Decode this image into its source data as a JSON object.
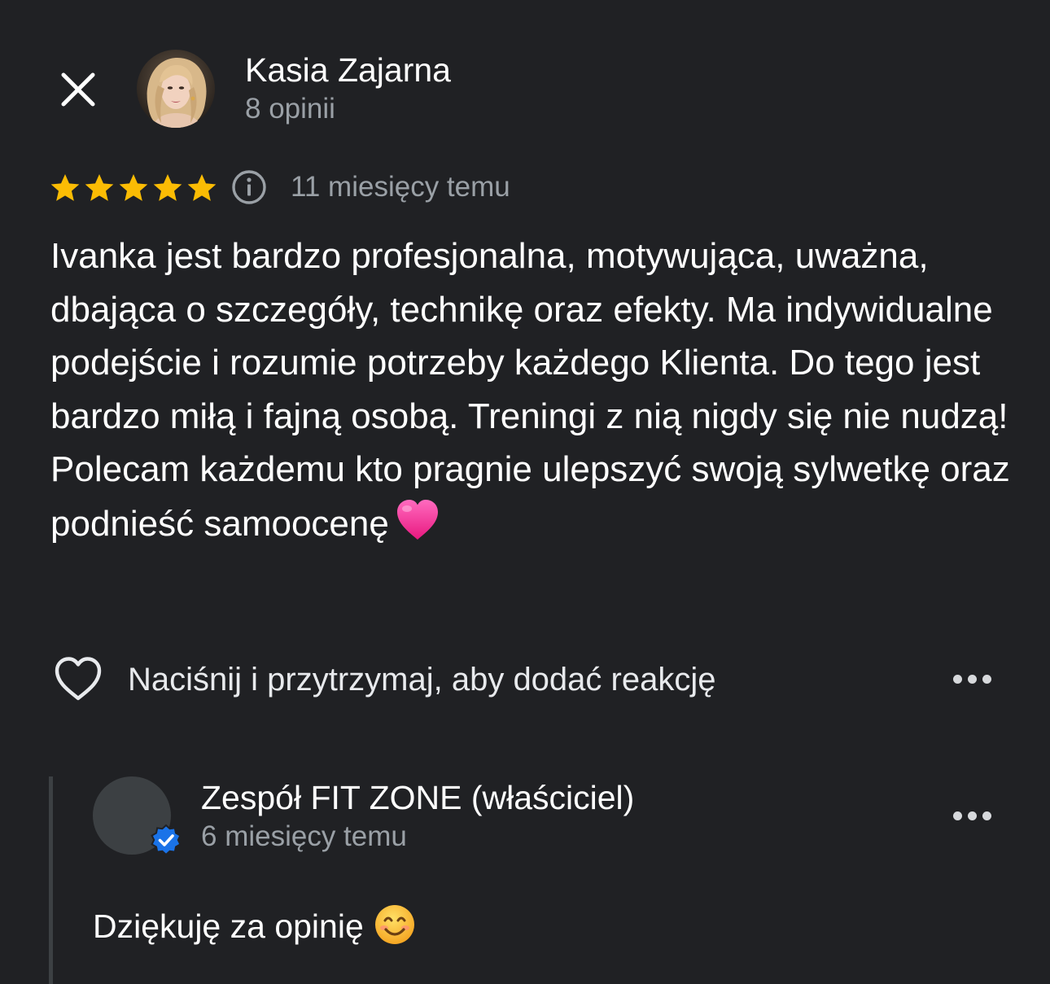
{
  "review": {
    "author": {
      "name": "Kasia Zajarna",
      "reviews_count": "8 opinii",
      "avatar": "profile-photo"
    },
    "rating": 5,
    "rating_max": 5,
    "time": "11 miesięcy temu",
    "text": "Ivanka jest bardzo profesjonalna, motywująca, uważna, dbająca o szczegóły, technikę oraz efekty. Ma indywidualne podejście i rozumie potrzeby każdego Klienta. Do tego jest bardzo miłą i fajną osobą. Treningi z nią nigdy się nie nudzą! Polecam każdemu kto pragnie ulepszyć swoją sylwetkę oraz podnieść samoocenę",
    "text_emoji": "pink-heart",
    "reaction_hint": "Naciśnij i przytrzymaj, aby dodać reakcję"
  },
  "owner_reply": {
    "name": "Zespół FIT ZONE (właściciel)",
    "time": "6 miesięcy temu",
    "text": "Dziękuję za opinię",
    "text_emoji": "smiling-face",
    "verified": true
  },
  "icons": {
    "close": "close-icon",
    "info": "info-icon",
    "like": "heart-outline-icon",
    "more": "more-horizontal-icon",
    "verified": "verified-check-icon"
  },
  "colors": {
    "background": "#202124",
    "text_primary": "#ffffff",
    "text_secondary": "#9aa0a6",
    "star": "#fbbc04",
    "verified": "#1a73e8",
    "reply_bar": "#3c4043"
  }
}
